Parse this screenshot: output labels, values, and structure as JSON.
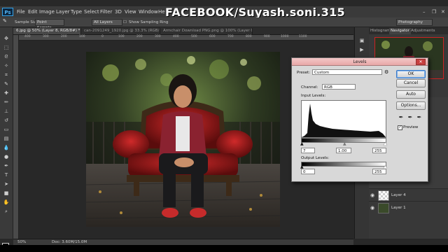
{
  "app": {
    "name": "Ps"
  },
  "menu": [
    "File",
    "Edit",
    "Image",
    "Layer",
    "Type",
    "Select",
    "Filter",
    "3D",
    "View",
    "Window",
    "He"
  ],
  "watermark": "FACEBOOK/Suyash.soni.315",
  "options": {
    "sample_size_label": "Sample Size:",
    "sample_size_value": "Point Sample",
    "sample_layers": "All Layers",
    "show_ring": "Show Sampling Ring",
    "workspace": "Photography"
  },
  "tabs": [
    {
      "label": "6.jpg @ 50% (Layer 8, RGB/8#) *",
      "active": true
    },
    {
      "label": "can-2091249_1920.jpg @ 33.3% (RGB/8#) *",
      "active": false
    },
    {
      "label": "Armchair Download PNG.png @ 100% (Layer 0, RGB/8#) *",
      "active": false
    }
  ],
  "ruler_ticks": [
    "400",
    "300",
    "200",
    "100",
    "0",
    "100",
    "200",
    "300",
    "400",
    "500",
    "600",
    "700",
    "800",
    "900",
    "1000",
    "1100"
  ],
  "status": {
    "zoom": "50%",
    "doc": "Doc: 3.60M/15.0M"
  },
  "right_panel": {
    "tabs": [
      "Histogram",
      "Navigator",
      "Adjustments"
    ],
    "active_tab": "Navigator",
    "layers": [
      {
        "name": "Layer 4"
      },
      {
        "name": "Layer 1"
      }
    ]
  },
  "levels": {
    "title": "Levels",
    "preset_label": "Preset:",
    "preset_value": "Custom",
    "channel_label": "Channel:",
    "channel_value": "RGB",
    "input_label": "Input Levels:",
    "input_values": [
      "7",
      "1.00",
      "255"
    ],
    "output_label": "Output Levels:",
    "output_values": [
      "0",
      "255"
    ],
    "buttons": [
      "OK",
      "Cancel",
      "Auto",
      "Options..."
    ],
    "preview_label": "Preview",
    "preview_checked": true
  },
  "colors": {
    "accent": "#4fb1f0",
    "dialog_title": "#e8a8a8",
    "close": "#c7403f"
  }
}
